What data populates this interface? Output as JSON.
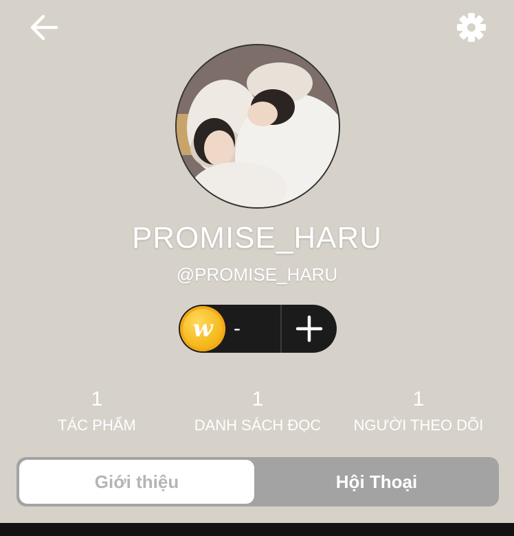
{
  "header": {
    "back_icon": "arrow-left-icon",
    "settings_icon": "gear-icon"
  },
  "profile": {
    "display_name": "PROMISE_HARU",
    "handle": "@PROMISE_HARU"
  },
  "coins": {
    "icon": "wattpad-coin-icon",
    "coin_letter": "w",
    "value": "-",
    "add_icon": "plus-icon"
  },
  "stats": [
    {
      "value": "1",
      "label": "TÁC PHẨM"
    },
    {
      "value": "1",
      "label": "DANH SÁCH ĐỌC"
    },
    {
      "value": "1",
      "label": "NGƯỜI THEO DÕI"
    }
  ],
  "tabs": [
    {
      "label": "Giới thiệu",
      "active": true
    },
    {
      "label": "Hội Thoại",
      "active": false
    }
  ],
  "colors": {
    "background": "#d6d1c9",
    "pill": "#1b1b1b",
    "coin": "#f5b91c",
    "tab_track": "#a3a3a3"
  }
}
